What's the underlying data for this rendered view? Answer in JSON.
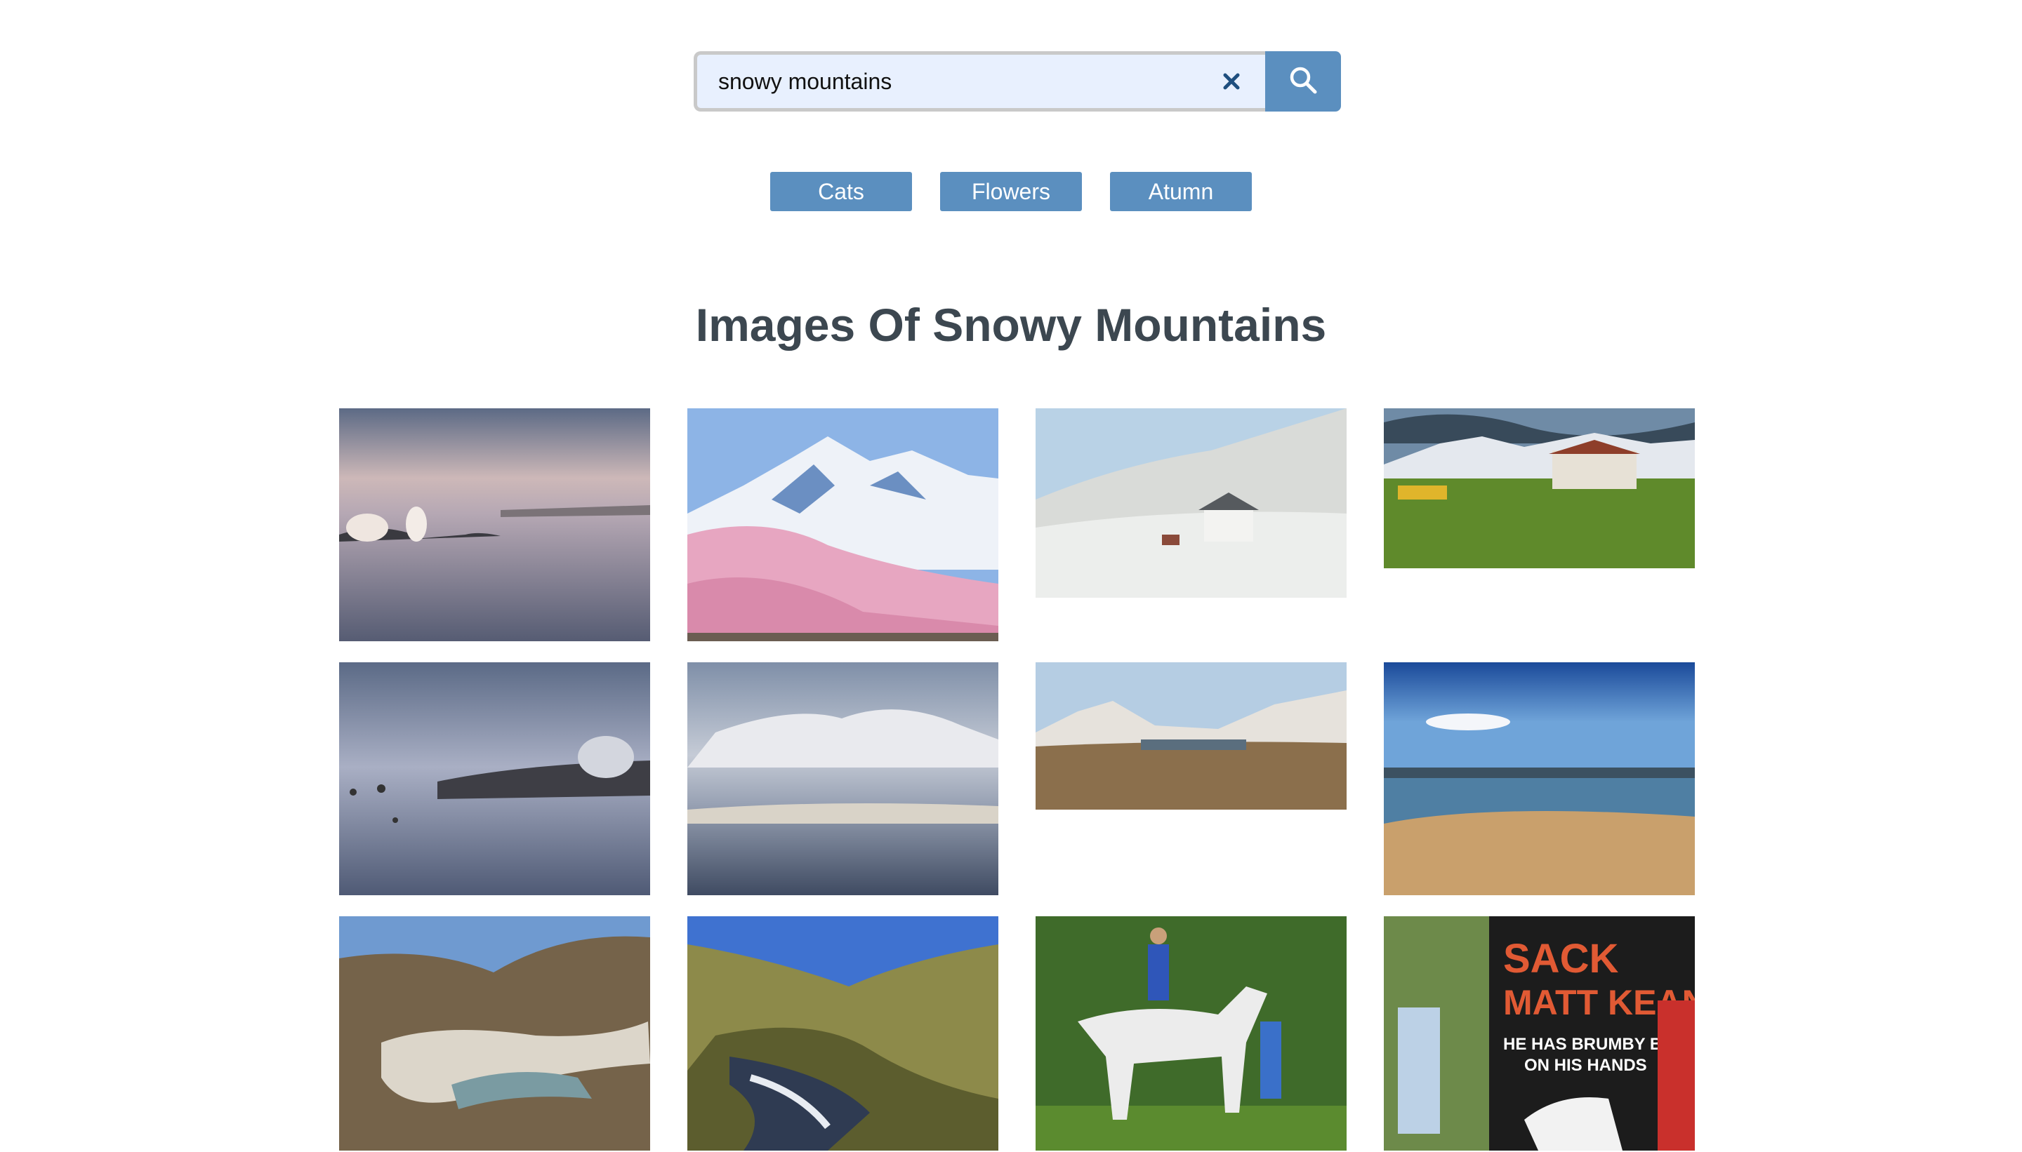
{
  "search": {
    "value": "snowy mountains",
    "placeholder": "",
    "clear_icon": "close-icon",
    "submit_icon": "search-icon"
  },
  "categories": [
    {
      "label": "Cats"
    },
    {
      "label": "Flowers"
    },
    {
      "label": "Atumn"
    }
  ],
  "page_title": "Images Of Snowy Mountains",
  "colors": {
    "accent": "#5b8fbf",
    "heading": "#3c4750",
    "search_bg": "#e8f0fe"
  },
  "images": [
    {
      "subject": "misty lake with frosted shrubs at dawn"
    },
    {
      "subject": "snow-capped mountain behind pink blossom trees"
    },
    {
      "subject": "white farmhouse in snowy valley"
    },
    {
      "subject": "green pasture with old shed and yellow truck, snowy peaks"
    },
    {
      "subject": "foggy lake with rocks reflecting"
    },
    {
      "subject": "misty snowy hills over calm lake"
    },
    {
      "subject": "snowy mountain range over brown plain"
    },
    {
      "subject": "lake with sandy shore under blue sky"
    },
    {
      "subject": "winding river in wooded valley"
    },
    {
      "subject": "rocky stream in grassy valley"
    },
    {
      "subject": "rider on white horse with people"
    },
    {
      "subject": "protest banner with horse image"
    }
  ]
}
